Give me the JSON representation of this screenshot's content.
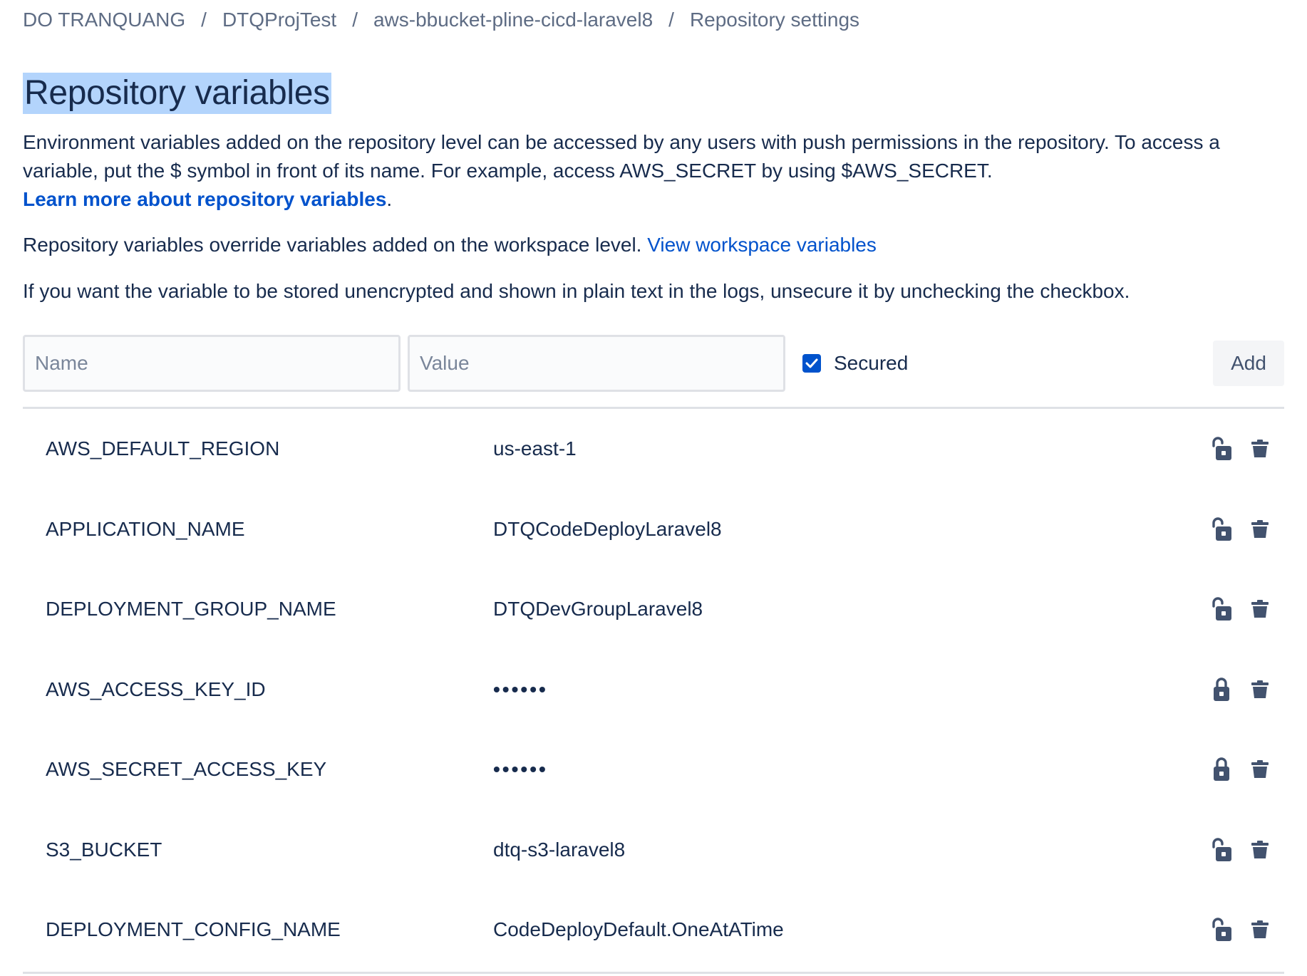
{
  "breadcrumb": {
    "items": [
      "DO TRANQUANG",
      "DTQProjTest",
      "aws-bbucket-pline-cicd-laravel8",
      "Repository settings"
    ],
    "separator": "/"
  },
  "page_title": "Repository variables",
  "intro": {
    "text": "Environment variables added on the repository level can be accessed by any users with push permissions in the repository. To access a variable, put the $ symbol in front of its name. For example, access AWS_SECRET by using $AWS_SECRET.",
    "learn_more_link": "Learn more about repository variables",
    "learn_more_suffix": "."
  },
  "override_note": {
    "text": "Repository variables override variables added on the workspace level.",
    "link": "View workspace variables"
  },
  "unsecure_note": "If you want the variable to be stored unencrypted and shown in plain text in the logs, unsecure it by unchecking the checkbox.",
  "form": {
    "name_placeholder": "Name",
    "value_placeholder": "Value",
    "secured_label": "Secured",
    "secured_checked": true,
    "add_label": "Add"
  },
  "variables": [
    {
      "name": "AWS_DEFAULT_REGION",
      "value": "us-east-1",
      "secured": false
    },
    {
      "name": "APPLICATION_NAME",
      "value": "DTQCodeDeployLaravel8",
      "secured": false
    },
    {
      "name": "DEPLOYMENT_GROUP_NAME",
      "value": "DTQDevGroupLaravel8",
      "secured": false
    },
    {
      "name": "AWS_ACCESS_KEY_ID",
      "value": "••••••",
      "secured": true
    },
    {
      "name": "AWS_SECRET_ACCESS_KEY",
      "value": "••••••",
      "secured": true
    },
    {
      "name": "S3_BUCKET",
      "value": "dtq-s3-laravel8",
      "secured": false
    },
    {
      "name": "DEPLOYMENT_CONFIG_NAME",
      "value": "CodeDeployDefault.OneAtATime",
      "secured": false
    }
  ],
  "icons": {
    "unlocked": "unlock-icon",
    "locked": "lock-icon",
    "delete": "trash-icon",
    "checkbox": "checkmark-icon"
  },
  "colors": {
    "link": "#0052cc",
    "text": "#172b4d",
    "muted": "#5e6c84",
    "title_highlight": "#b3d4fc",
    "icon": "#42526e",
    "checkbox": "#0052cc"
  }
}
